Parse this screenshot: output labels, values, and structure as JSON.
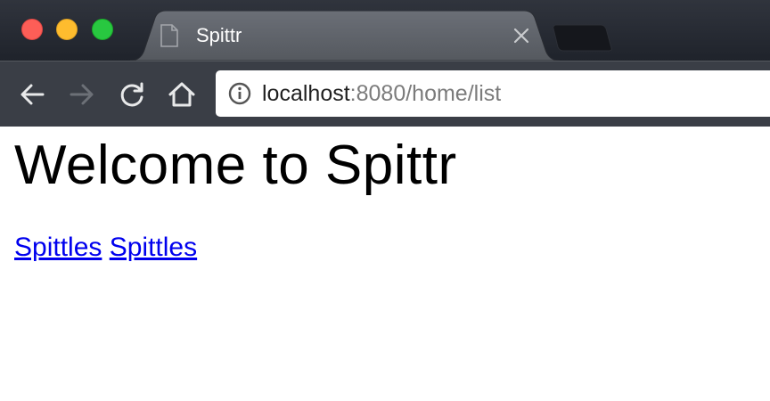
{
  "window": {
    "controls": [
      "close",
      "minimize",
      "maximize"
    ]
  },
  "tab": {
    "title": "Spittr",
    "icon": "page-icon",
    "close_icon": "close-icon"
  },
  "toolbar": {
    "buttons": [
      "back-icon",
      "forward-icon",
      "reload-icon",
      "home-icon"
    ]
  },
  "address_bar": {
    "icon": "info-icon",
    "host": "localhost",
    "rest": ":8080/home/list"
  },
  "page": {
    "heading": "Welcome to Spittr",
    "links": [
      {
        "label": "Spittles"
      },
      {
        "label": "Spittles"
      }
    ]
  },
  "colors": {
    "link": "#0000ee",
    "tab_bar": "#23262e",
    "toolbar": "#3a3e46",
    "close": "#fd5e57",
    "minimize": "#febc2e",
    "maximize": "#28c840"
  }
}
